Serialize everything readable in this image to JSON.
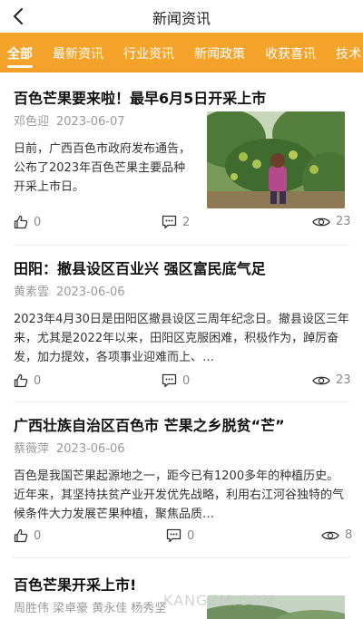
{
  "header": {
    "title": "新闻资讯",
    "back_icon": "chevron-left-icon"
  },
  "tabs": [
    {
      "label": "全部",
      "active": true
    },
    {
      "label": "最新资讯",
      "active": false
    },
    {
      "label": "行业资讯",
      "active": false
    },
    {
      "label": "新闻政策",
      "active": false
    },
    {
      "label": "收获喜讯",
      "active": false
    },
    {
      "label": "技术",
      "active": false
    }
  ],
  "articles": [
    {
      "title": "百色芒果要来啦！最早6月5日开采上市",
      "author": "邓色迎",
      "date": "2023-06-07",
      "summary": "日前，广西百色市政府发布通告，公布了2023年百色芒果主要品种开采上市日。",
      "likes": "0",
      "comments": "2",
      "views": "23",
      "image": "mango-orchard-photo"
    },
    {
      "title": "田阳：撤县设区百业兴 强区富民底气足",
      "author": "黄素雲",
      "date": "2023-06-06",
      "summary": "2023年4月30日是田阳区撤县设区三周年纪念日。撤县设区三年来，尤其是2022年以来，田阳区克服困难，积极作为，踔厉奋发，加力提效，各项事业迎难而上、…",
      "likes": "0",
      "comments": "0",
      "views": "23"
    },
    {
      "title": "广西壮族自治区百色市 芒果之乡脱贫“芒”",
      "author": "蔡薇萍",
      "date": "2023-06-06",
      "summary": "百色是我国芒果起源地之一，距今已有1200多年的种植历史。近年来，其坚持扶贫产业开发优先战略，利用右江河谷独特的气候条件大力发展芒果种植，聚焦品质…",
      "likes": "0",
      "comments": "0",
      "views": "8"
    },
    {
      "title": "百色芒果开采上市!",
      "authors": "周胜伟 梁卓豪 黄永佳 杨秀坚",
      "image": "mango-field-photo"
    }
  ],
  "watermark": "KANGZM.COM",
  "colors": {
    "accent": "#f3a02a",
    "tab_text": "#ffffff",
    "meta_text": "#9a9a9a"
  }
}
